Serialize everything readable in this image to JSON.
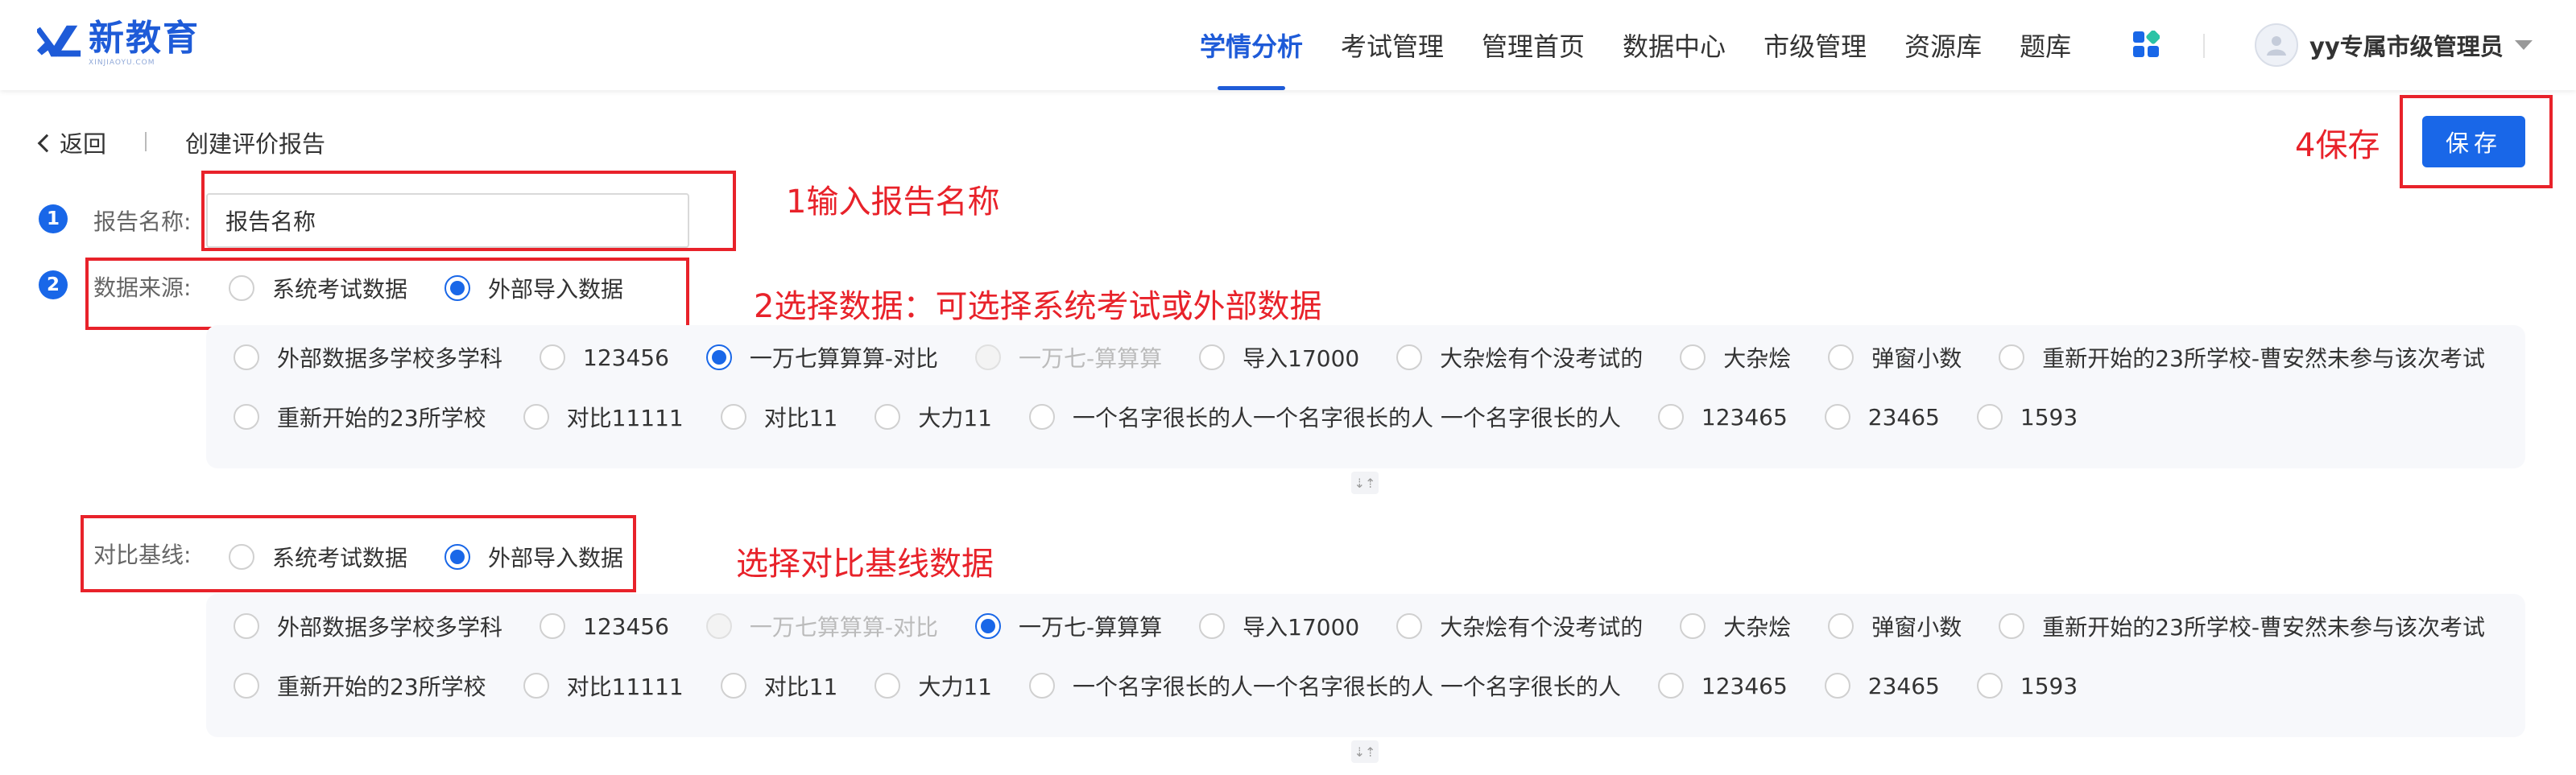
{
  "brand": {
    "name": "新教育",
    "sub": "XINJIAOYU.COM"
  },
  "nav": {
    "items": [
      {
        "label": "学情分析",
        "active": true
      },
      {
        "label": "考试管理",
        "active": false
      },
      {
        "label": "管理首页",
        "active": false
      },
      {
        "label": "数据中心",
        "active": false
      },
      {
        "label": "市级管理",
        "active": false
      },
      {
        "label": "资源库",
        "active": false
      },
      {
        "label": "题库",
        "active": false
      }
    ]
  },
  "user": {
    "name": "yy专属市级管理员"
  },
  "subheader": {
    "back_label": "返回",
    "title": "创建评价报告"
  },
  "toolbar": {
    "save_label": "保存"
  },
  "form": {
    "name": {
      "step": "1",
      "label": "报告名称:",
      "value": "报告名称"
    },
    "source": {
      "step": "2",
      "label": "数据来源:",
      "options": [
        {
          "label": "系统考试数据",
          "checked": false
        },
        {
          "label": "外部导入数据",
          "checked": true
        }
      ],
      "items_row1": [
        {
          "label": "外部数据多学校多学科",
          "state": "unchecked"
        },
        {
          "label": "123456",
          "state": "unchecked"
        },
        {
          "label": "一万七算算算-对比",
          "state": "checked"
        },
        {
          "label": "一万七-算算算",
          "state": "disabled"
        },
        {
          "label": "导入17000",
          "state": "unchecked"
        },
        {
          "label": "大杂烩有个没考试的",
          "state": "unchecked"
        },
        {
          "label": "大杂烩",
          "state": "unchecked"
        },
        {
          "label": "弹窗小数",
          "state": "unchecked"
        },
        {
          "label": "重新开始的23所学校-曹安然未参与该次考试",
          "state": "unchecked"
        }
      ],
      "items_row2": [
        {
          "label": "重新开始的23所学校",
          "state": "unchecked"
        },
        {
          "label": "对比11111",
          "state": "unchecked"
        },
        {
          "label": "对比11",
          "state": "unchecked"
        },
        {
          "label": "大力11",
          "state": "unchecked"
        },
        {
          "label": "一个名字很长的人一个名字很长的人 一个名字很长的人",
          "state": "unchecked"
        },
        {
          "label": "123465",
          "state": "unchecked"
        },
        {
          "label": "23465",
          "state": "unchecked"
        },
        {
          "label": "1593",
          "state": "unchecked"
        }
      ]
    },
    "baseline": {
      "label": "对比基线:",
      "options": [
        {
          "label": "系统考试数据",
          "checked": false
        },
        {
          "label": "外部导入数据",
          "checked": true
        }
      ],
      "items_row1": [
        {
          "label": "外部数据多学校多学科",
          "state": "unchecked"
        },
        {
          "label": "123456",
          "state": "unchecked"
        },
        {
          "label": "一万七算算算-对比",
          "state": "disabled"
        },
        {
          "label": "一万七-算算算",
          "state": "checked"
        },
        {
          "label": "导入17000",
          "state": "unchecked"
        },
        {
          "label": "大杂烩有个没考试的",
          "state": "unchecked"
        },
        {
          "label": "大杂烩",
          "state": "unchecked"
        },
        {
          "label": "弹窗小数",
          "state": "unchecked"
        },
        {
          "label": "重新开始的23所学校-曹安然未参与该次考试",
          "state": "unchecked"
        }
      ],
      "items_row2": [
        {
          "label": "重新开始的23所学校",
          "state": "unchecked"
        },
        {
          "label": "对比11111",
          "state": "unchecked"
        },
        {
          "label": "对比11",
          "state": "unchecked"
        },
        {
          "label": "大力11",
          "state": "unchecked"
        },
        {
          "label": "一个名字很长的人一个名字很长的人 一个名字很长的人",
          "state": "unchecked"
        },
        {
          "label": "123465",
          "state": "unchecked"
        },
        {
          "label": "23465",
          "state": "unchecked"
        },
        {
          "label": "1593",
          "state": "unchecked"
        }
      ]
    }
  },
  "annotations": {
    "name": "1输入报告名称",
    "source": "2选择数据：可选择系统考试或外部数据",
    "baseline": "选择对比基线数据",
    "save": "4保存"
  },
  "colors": {
    "primary": "#1967e8",
    "annotation": "#e8222a",
    "panel_bg": "#f7f8fb"
  }
}
